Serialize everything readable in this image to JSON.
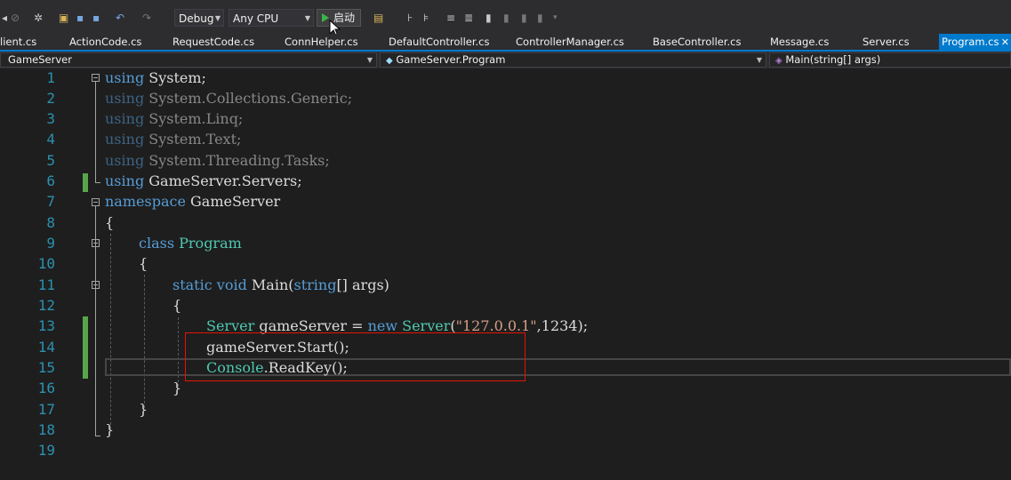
{
  "toolbar": {
    "configuration": "Debug",
    "platform": "Any CPU",
    "start_label": "启动"
  },
  "tabs": [
    {
      "label": "lient.cs",
      "active": false
    },
    {
      "label": "ActionCode.cs",
      "active": false
    },
    {
      "label": "RequestCode.cs",
      "active": false
    },
    {
      "label": "ConnHelper.cs",
      "active": false
    },
    {
      "label": "DefaultController.cs",
      "active": false
    },
    {
      "label": "ControllerManager.cs",
      "active": false
    },
    {
      "label": "BaseController.cs",
      "active": false
    },
    {
      "label": "Message.cs",
      "active": false
    },
    {
      "label": "Server.cs",
      "active": false
    },
    {
      "label": "Program.cs",
      "active": true
    }
  ],
  "navbar": {
    "project": "GameServer",
    "type": "GameServer.Program",
    "member": "Main(string[] args)"
  },
  "editor": {
    "line_numbers": [
      "1",
      "2",
      "3",
      "4",
      "5",
      "6",
      "7",
      "8",
      "9",
      "10",
      "11",
      "12",
      "13",
      "14",
      "15",
      "16",
      "17",
      "18",
      "19"
    ],
    "lines": {
      "l1_kw": "using",
      "l1_rest": " System;",
      "l2_kw": "using",
      "l2_rest": " System.Collections.Generic;",
      "l3_kw": "using",
      "l3_rest": " System.Linq;",
      "l4_kw": "using",
      "l4_rest": " System.Text;",
      "l5_kw": "using",
      "l5_rest": " System.Threading.Tasks;",
      "l6_kw": "using",
      "l6_rest": " GameServer.Servers;",
      "l7_kw": "namespace",
      "l7_rest": " GameServer",
      "l8": "{",
      "l9_kw": "class",
      "l9_type": "Program",
      "l10": "{",
      "l11_kw": "static void",
      "l11_name": " Main(",
      "l11_kw2": "string",
      "l11_rest": "[] args)",
      "l12": "{",
      "l13_type": "Server",
      "l13_mid": " gameServer = ",
      "l13_kw": "new",
      "l13_type2": "Server",
      "l13_open": "(",
      "l13_str": "\"127.0.0.1\"",
      "l13_tail": ",1234);",
      "l14": "gameServer.Start();",
      "l15_type": "Console",
      "l15_rest": ".ReadKey();",
      "l16": "}",
      "l17": "}",
      "l18": "}"
    }
  },
  "icons": [
    "back-icon",
    "forward-icon",
    "new-project-icon",
    "open-file-icon",
    "save-icon",
    "save-all-icon",
    "undo-icon",
    "redo-icon",
    "play-icon",
    "browser-link-icon",
    "step-icon",
    "comment-icon",
    "bookmark-icon",
    "mouse-cursor-icon"
  ]
}
